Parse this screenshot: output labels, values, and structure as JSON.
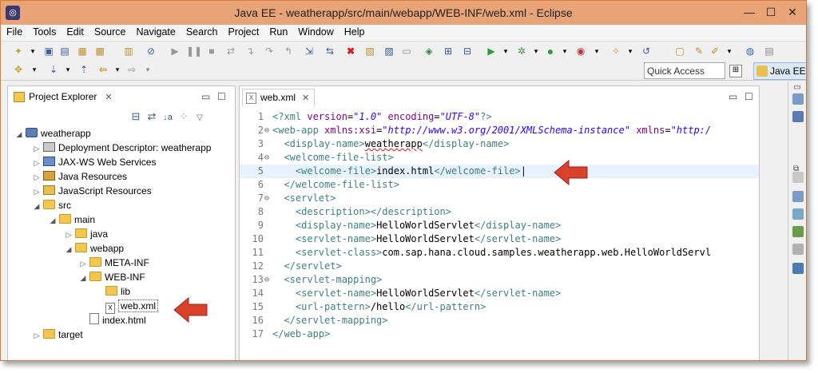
{
  "window": {
    "title": "Java EE - weatherapp/src/main/webapp/WEB-INF/web.xml - Eclipse",
    "controls": [
      "minimize-icon",
      "maximize-icon",
      "close-icon"
    ]
  },
  "menu": [
    "File",
    "Tools",
    "Edit",
    "Source",
    "Navigate",
    "Search",
    "Project",
    "Run",
    "Window",
    "Help"
  ],
  "toolbar": {
    "quick_access": "Quick Access",
    "perspective": "Java EE"
  },
  "project_explorer": {
    "title": "Project Explorer",
    "tree": [
      {
        "label": "weatherapp",
        "icon": "project-icon",
        "expanded": true
      },
      {
        "label": "Deployment Descriptor: weatherapp",
        "icon": "deployment-descriptor-icon"
      },
      {
        "label": "JAX-WS Web Services",
        "icon": "web-services-icon"
      },
      {
        "label": "Java Resources",
        "icon": "java-resources-icon"
      },
      {
        "label": "JavaScript Resources",
        "icon": "javascript-resources-icon"
      },
      {
        "label": "src",
        "icon": "folder-icon",
        "expanded": true
      },
      {
        "label": "main",
        "icon": "folder-icon",
        "expanded": true
      },
      {
        "label": "java",
        "icon": "folder-icon"
      },
      {
        "label": "webapp",
        "icon": "folder-icon",
        "expanded": true
      },
      {
        "label": "META-INF",
        "icon": "folder-icon"
      },
      {
        "label": "WEB-INF",
        "icon": "folder-icon",
        "expanded": true
      },
      {
        "label": "lib",
        "icon": "folder-icon"
      },
      {
        "label": "web.xml",
        "icon": "xml-file-icon",
        "selected": true
      },
      {
        "label": "index.html",
        "icon": "html-file-icon"
      },
      {
        "label": "target",
        "icon": "folder-icon"
      }
    ]
  },
  "editor": {
    "tab_label": "web.xml",
    "current_line": 5,
    "lines": [
      {
        "n": "1",
        "text": "<?xml version=\"1.0\" encoding=\"UTF-8\"?>"
      },
      {
        "n": "2",
        "text": "<web-app xmlns:xsi=\"http://www.w3.org/2001/XMLSchema-instance\" xmlns=\"http:/"
      },
      {
        "n": "3",
        "text": "  <display-name>weatherapp</display-name>"
      },
      {
        "n": "4",
        "text": "  <welcome-file-list>"
      },
      {
        "n": "5",
        "text": "    <welcome-file>index.html</welcome-file>"
      },
      {
        "n": "6",
        "text": "  </welcome-file-list>"
      },
      {
        "n": "7",
        "text": "  <servlet>"
      },
      {
        "n": "8",
        "text": "    <description></description>"
      },
      {
        "n": "9",
        "text": "    <display-name>HelloWorldServlet</display-name>"
      },
      {
        "n": "10",
        "text": "    <servlet-name>HelloWorldServlet</servlet-name>"
      },
      {
        "n": "11",
        "text": "    <servlet-class>com.sap.hana.cloud.samples.weatherapp.web.HelloWorldServl"
      },
      {
        "n": "12",
        "text": "  </servlet>"
      },
      {
        "n": "13",
        "text": "  <servlet-mapping>"
      },
      {
        "n": "14",
        "text": "    <servlet-name>HelloWorldServlet</servlet-name>"
      },
      {
        "n": "15",
        "text": "    <url-pattern>/hello</url-pattern>"
      },
      {
        "n": "16",
        "text": "  </servlet-mapping>"
      },
      {
        "n": "17",
        "text": "</web-app>"
      }
    ]
  },
  "colors": {
    "titlebar": "#e8a476",
    "annotation_arrow": "#d9412b",
    "xml_tag": "#3f7f7f",
    "xml_attr": "#7f007f",
    "xml_value": "#2a00ff"
  }
}
